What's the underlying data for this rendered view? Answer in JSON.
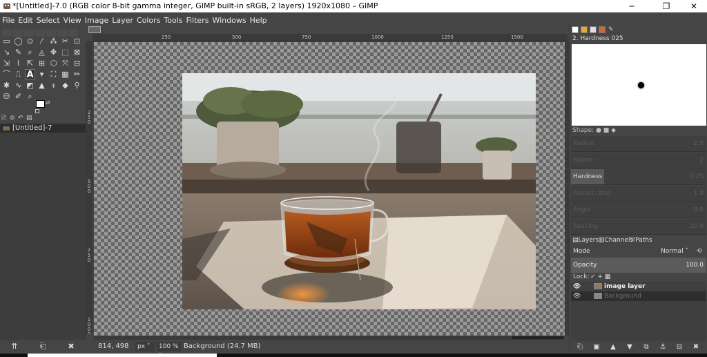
{
  "window": {
    "title": "*[Untitled]-7.0 (RGB color 8-bit gamma integer, GIMP built-in sRGB, 2 layers) 1920x1080 – GIMP",
    "minimize": "─",
    "maximize": "❐",
    "close": "✕"
  },
  "menu": [
    "File",
    "Edit",
    "Select",
    "View",
    "Image",
    "Layer",
    "Colors",
    "Tools",
    "Filters",
    "Windows",
    "Help"
  ],
  "toolbox": {
    "tools": [
      "▭",
      "◯",
      "⊙",
      "⁄",
      "⁂",
      "✂",
      "⊡",
      "↘",
      "✎",
      "⌕",
      "◬",
      "✥",
      "⬚",
      "⊠",
      "⇲",
      "⌇",
      "⇱",
      "⊞",
      "⬡",
      "⤧",
      "⊟",
      "⌒",
      "⎍",
      "A",
      "▾",
      "⛶",
      "▦",
      "✏",
      "✱",
      "∿",
      "◩",
      "▲",
      "⌽",
      "◆",
      "⚲",
      "⛁",
      "✐",
      "⌕"
    ],
    "image_tab_icons": [
      "⎚",
      "⊘",
      "↶",
      "▤"
    ],
    "image_name": "[Untitled]-7",
    "bottom_buttons": [
      "⇈",
      "⎗",
      "✖"
    ]
  },
  "canvas": {
    "ruler_h": [
      "250",
      "500",
      "750",
      "1000",
      "1250",
      "1500"
    ],
    "ruler_v": [
      "2\n5\n0",
      "5\n0\n0",
      "7\n5\n0",
      "1\n0\n0\n0"
    ]
  },
  "status": {
    "coords": "814, 498",
    "unit": "px",
    "zoom": "100 %",
    "message": "Background (24.7 MB)"
  },
  "dock": {
    "brush_name": "2. Hardness 025",
    "shape_label": "Shape:",
    "shape_values": "● ■ ◆",
    "options": [
      {
        "label": "Radius",
        "value": "2.0"
      },
      {
        "label": "Spikes",
        "value": "2"
      },
      {
        "label": "Hardness",
        "value": "0.25"
      },
      {
        "label": "Aspect ratio",
        "value": "1.0"
      },
      {
        "label": "Angle",
        "value": "0.0"
      },
      {
        "label": "Spacing",
        "value": "10.0"
      }
    ],
    "layer_tabs": [
      "Layers",
      "Channels",
      "Paths"
    ],
    "mode_label": "Mode",
    "mode_value": "Normal",
    "opacity_label": "Opacity",
    "opacity_value": "100.0",
    "lock_label": "Lock:",
    "lock_icons": "✓ + ▦",
    "layers": [
      {
        "name": "image layer",
        "active": true
      },
      {
        "name": "Background",
        "active": false
      }
    ],
    "bottom_buttons": [
      "⎗",
      "▣",
      "▲",
      "▼",
      "⧉",
      "⚓",
      "⊟",
      "✖"
    ]
  },
  "colors": {
    "foreground": "#ffffff",
    "background": "#ff0000"
  }
}
